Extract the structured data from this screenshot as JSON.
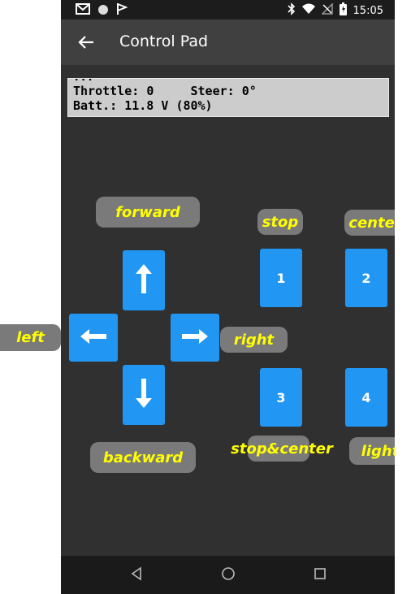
{
  "status_bar": {
    "time": "15:05",
    "icons": [
      "gmail-icon",
      "circle-icon",
      "flag-icon",
      "bluetooth-icon",
      "wifi-icon",
      "no-sim-icon",
      "battery-icon"
    ]
  },
  "app_bar": {
    "title": "Control Pad",
    "back_icon": "arrow-left-icon"
  },
  "telemetry": {
    "truncated_line": "...",
    "throttle_label": "Throttle:",
    "throttle_value": "0",
    "steer_label": "Steer:",
    "steer_value": "0°",
    "battery_label": "Batt.:",
    "battery_value": "11.8 V",
    "battery_percent": "(80%)"
  },
  "dpad": {
    "up_icon": "arrow-up-icon",
    "down_icon": "arrow-down-icon",
    "left_icon": "arrow-left-icon",
    "right_icon": "arrow-right-icon"
  },
  "labels": {
    "forward": "forward",
    "backward": "backward",
    "left": "left",
    "right": "right",
    "stop": "stop",
    "center": "center",
    "stop_center": "stop&center",
    "light": "light"
  },
  "buttons": {
    "b1": "1",
    "b2": "2",
    "b3": "3",
    "b4": "4"
  },
  "nav": {
    "back": "triangle-back-icon",
    "home": "circle-home-icon",
    "recents": "square-recents-icon"
  },
  "colors": {
    "button": "#2196f3",
    "label_bg": "#7a7a7a",
    "label_text": "#ffff00"
  }
}
